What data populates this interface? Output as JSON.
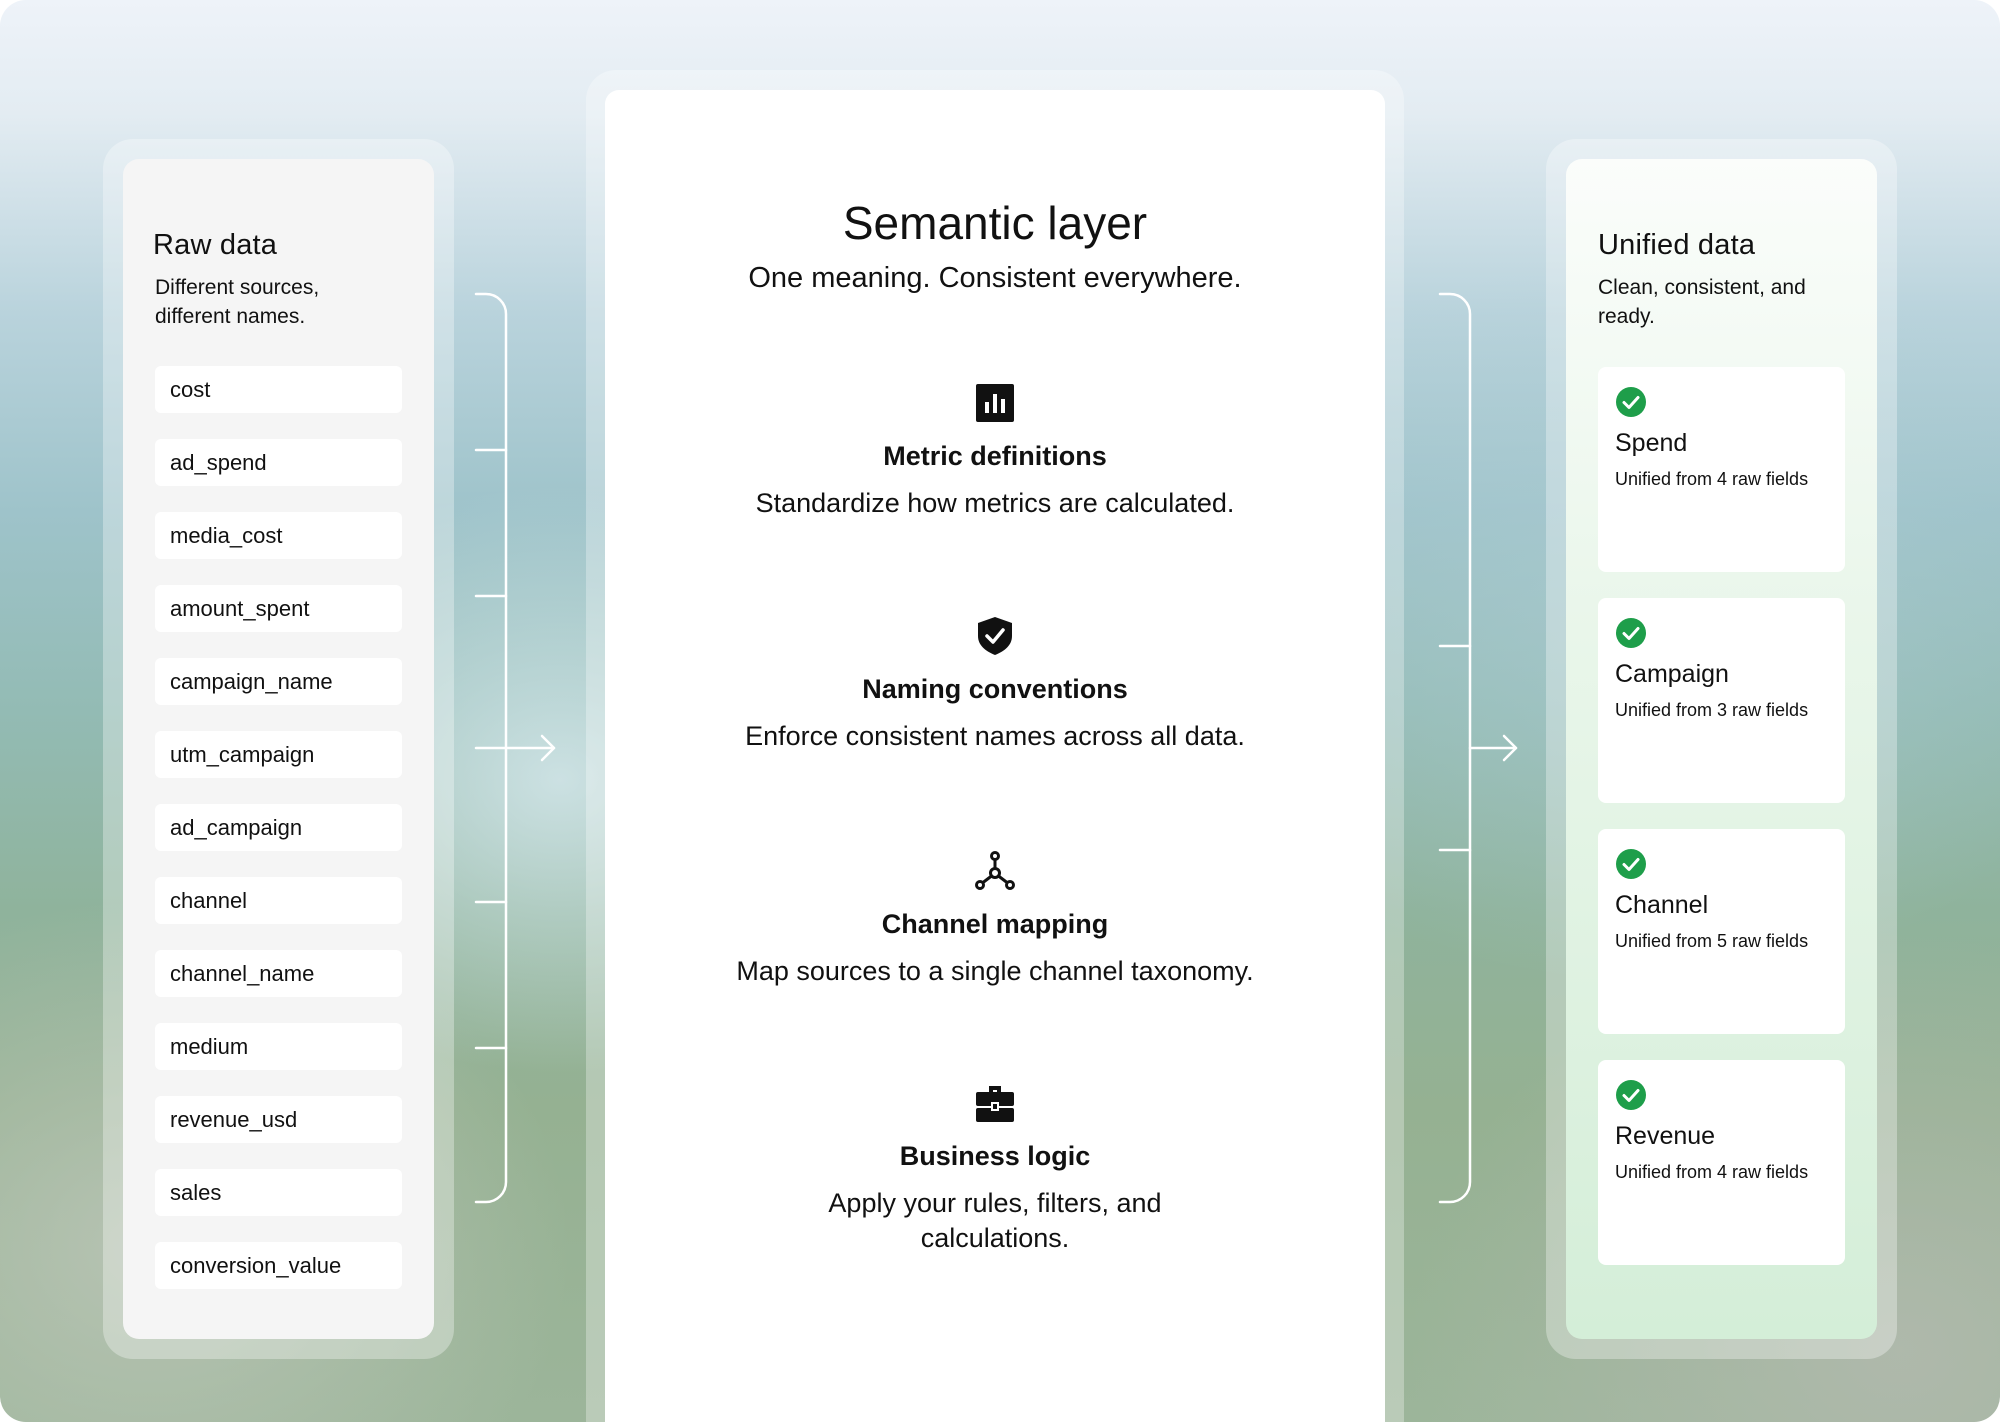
{
  "raw_data": {
    "title": "Raw data",
    "subtitle": "Different sources, different names.",
    "fields": [
      "cost",
      "ad_spend",
      "media_cost",
      "amount_spent",
      "campaign_name",
      "utm_campaign",
      "ad_campaign",
      "channel",
      "channel_name",
      "medium",
      "revenue_usd",
      "sales",
      "conversion_value"
    ]
  },
  "semantic_layer": {
    "title": "Semantic layer",
    "subtitle": "One meaning. Consistent everywhere.",
    "features": [
      {
        "icon": "bar-chart-icon",
        "title": "Metric definitions",
        "description": "Standardize how metrics are calculated."
      },
      {
        "icon": "shield-check-icon",
        "title": "Naming conventions",
        "description": "Enforce consistent names across all data."
      },
      {
        "icon": "network-nodes-icon",
        "title": "Channel mapping",
        "description": "Map sources to a single channel taxonomy."
      },
      {
        "icon": "briefcase-icon",
        "title": "Business logic",
        "description": "Apply your rules, filters, and calculations."
      }
    ]
  },
  "unified_data": {
    "title": "Unified data",
    "subtitle": "Clean, consistent, and ready.",
    "items": [
      {
        "name": "Spend",
        "description": "Unified from 4 raw fields"
      },
      {
        "name": "Campaign",
        "description": "Unified from 3 raw fields"
      },
      {
        "name": "Channel",
        "description": "Unified from 5 raw fields"
      },
      {
        "name": "Revenue",
        "description": "Unified from 4 raw fields"
      }
    ]
  },
  "colors": {
    "check_green": "#1e9e4a",
    "connector": "#ffffff"
  }
}
